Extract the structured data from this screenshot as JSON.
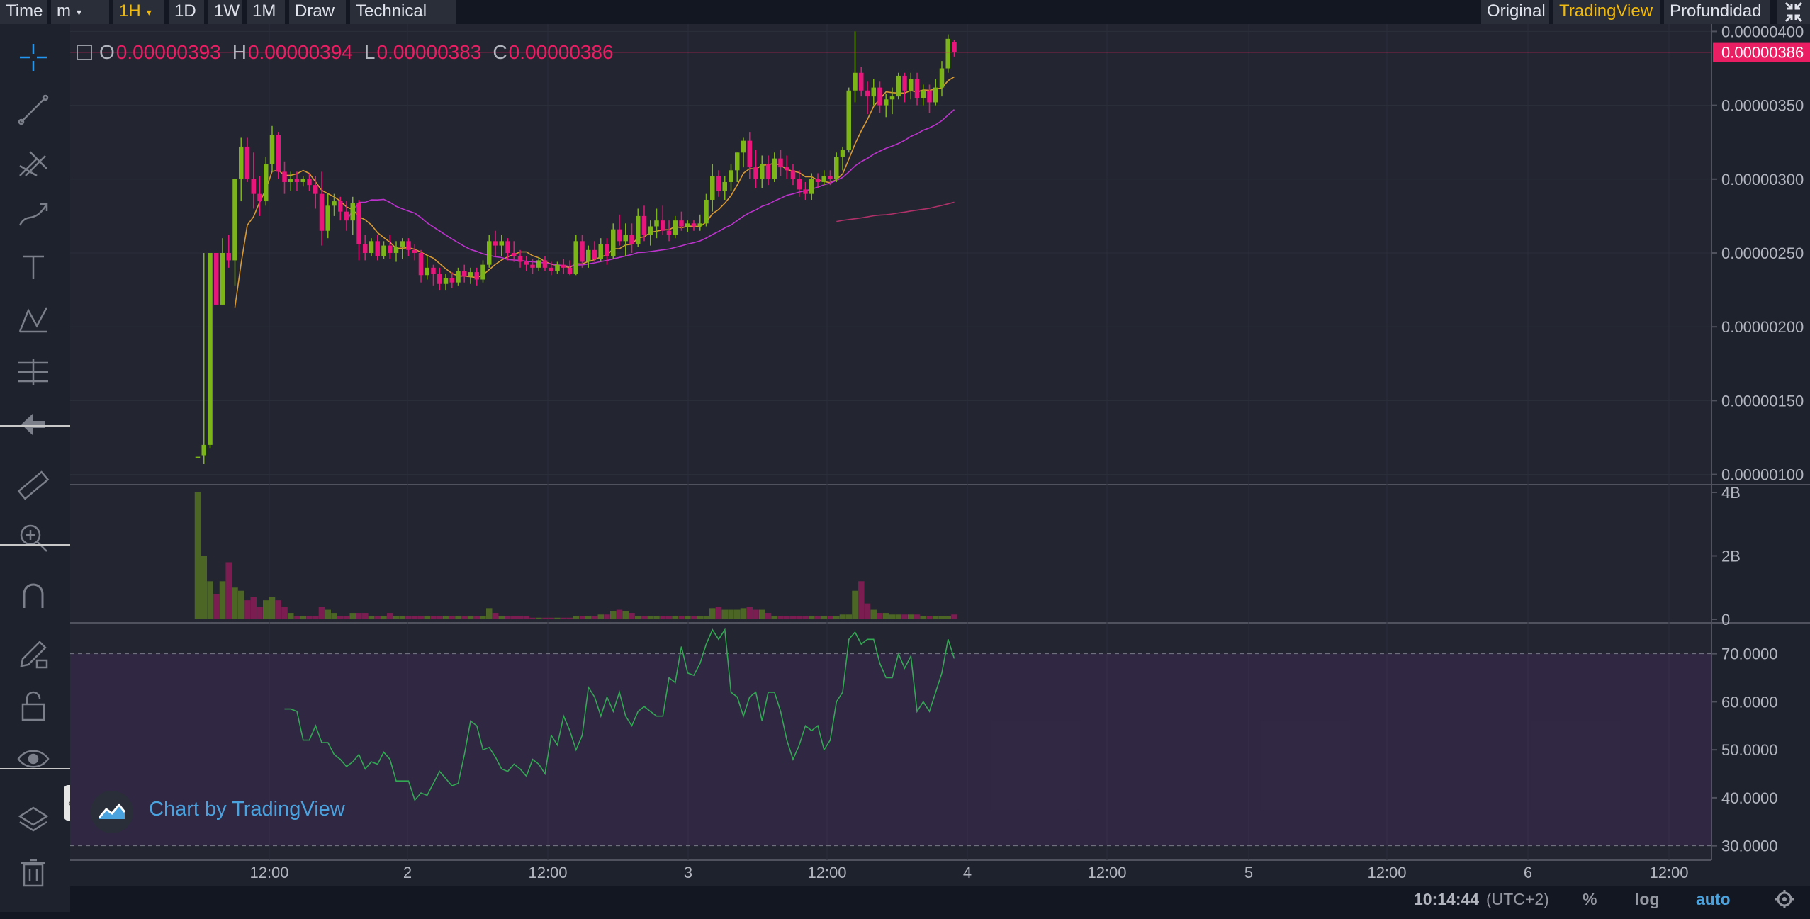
{
  "toolbar": {
    "items": [
      {
        "label": "Time"
      },
      {
        "label": "m",
        "caret": "▾"
      },
      {
        "label": "1H",
        "caret": "▾",
        "active": true
      },
      {
        "label": "1D"
      },
      {
        "label": "1W"
      },
      {
        "label": "1M"
      },
      {
        "label": "Draw"
      },
      {
        "label": "Technical Ind"
      }
    ],
    "views": [
      {
        "label": "Original"
      },
      {
        "label": "TradingView",
        "active": true
      },
      {
        "label": "Profundidad"
      }
    ],
    "fullscreen_icon": "collapse-arrows-icon"
  },
  "left_tools": [
    "crosshair-icon",
    "trend-line-icon",
    "pitchfork-icon",
    "brush-icon",
    "text-icon",
    "pattern-icon",
    "fib-levels-icon",
    "back-arrow-icon",
    "ruler-icon",
    "zoom-in-icon",
    "magnet-icon",
    "lock-drawing-icon",
    "unlock-icon",
    "eye-icon",
    "layers-icon",
    "trash-icon"
  ],
  "legend": {
    "o_label": "O",
    "o_value": "0.00000393",
    "h_label": "H",
    "h_value": "0.00000394",
    "l_label": "L",
    "l_value": "0.00000383",
    "c_label": "C",
    "c_value": "0.00000386"
  },
  "watermark": "Chart by TradingView",
  "bottom_bar": {
    "time": "10:14:44",
    "tz": "(UTC+2)",
    "percent": "%",
    "log": "log",
    "auto": "auto",
    "settings_icon": "gear-icon"
  },
  "colors": {
    "up": "#7cb518",
    "down": "#e8157b",
    "ma_short": "#d99a33",
    "ma_mid": "#bb33cc",
    "ma_long": "#b0306a",
    "rsi": "#32a852",
    "accent": "#f0b90b",
    "price_tag": "#e91e63"
  },
  "chart_data": {
    "type": "candlestick",
    "price_axis": {
      "ylim": [
        9.5e-07,
        4.05e-06
      ],
      "ticks": [
        "0.00000400",
        "0.00000350",
        "0.00000300",
        "0.00000250",
        "0.00000200",
        "0.00000150",
        "0.00000100"
      ],
      "last_price": "0.00000386"
    },
    "time_axis": {
      "labels": [
        "12:00",
        "2",
        "12:00",
        "3",
        "12:00",
        "4",
        "12:00",
        "5",
        "12:00",
        "6",
        "12:00"
      ]
    },
    "candles_ohlc": [
      [
        112,
        112,
        112,
        112
      ],
      [
        113,
        250,
        107,
        120
      ],
      [
        120,
        250,
        118,
        250
      ],
      [
        250,
        250,
        215,
        215
      ],
      [
        215,
        260,
        215,
        250
      ],
      [
        250,
        262,
        240,
        245
      ],
      [
        245,
        300,
        228,
        300
      ],
      [
        300,
        328,
        285,
        322
      ],
      [
        322,
        328,
        298,
        300
      ],
      [
        300,
        318,
        280,
        290
      ],
      [
        290,
        302,
        275,
        285
      ],
      [
        285,
        315,
        282,
        310
      ],
      [
        310,
        336,
        305,
        330
      ],
      [
        330,
        332,
        300,
        305
      ],
      [
        305,
        312,
        290,
        298
      ],
      [
        298,
        305,
        292,
        300
      ],
      [
        300,
        305,
        292,
        298
      ],
      [
        298,
        302,
        295,
        300
      ],
      [
        300,
        304,
        292,
        296
      ],
      [
        296,
        302,
        280,
        290
      ],
      [
        290,
        305,
        255,
        265
      ],
      [
        265,
        290,
        260,
        282
      ],
      [
        282,
        290,
        275,
        285
      ],
      [
        285,
        288,
        272,
        278
      ],
      [
        278,
        285,
        265,
        272
      ],
      [
        272,
        288,
        262,
        284
      ],
      [
        284,
        286,
        245,
        256
      ],
      [
        256,
        262,
        245,
        250
      ],
      [
        250,
        260,
        248,
        258
      ],
      [
        258,
        262,
        245,
        248
      ],
      [
        248,
        258,
        246,
        255
      ],
      [
        255,
        262,
        246,
        250
      ],
      [
        250,
        258,
        244,
        254
      ],
      [
        254,
        260,
        246,
        258
      ],
      [
        258,
        260,
        248,
        252
      ],
      [
        252,
        256,
        245,
        250
      ],
      [
        250,
        252,
        230,
        235
      ],
      [
        235,
        248,
        232,
        240
      ],
      [
        240,
        242,
        228,
        236
      ],
      [
        236,
        240,
        225,
        229
      ],
      [
        229,
        236,
        225,
        233
      ],
      [
        233,
        237,
        226,
        230
      ],
      [
        230,
        240,
        228,
        238
      ],
      [
        238,
        242,
        230,
        234
      ],
      [
        234,
        240,
        229,
        237
      ],
      [
        237,
        240,
        228,
        232
      ],
      [
        232,
        245,
        230,
        242
      ],
      [
        242,
        262,
        240,
        258
      ],
      [
        258,
        265,
        248,
        255
      ],
      [
        255,
        262,
        248,
        258
      ],
      [
        258,
        260,
        245,
        250
      ],
      [
        250,
        258,
        244,
        248
      ],
      [
        248,
        252,
        240,
        244
      ],
      [
        244,
        248,
        238,
        242
      ],
      [
        242,
        246,
        236,
        240
      ],
      [
        240,
        247,
        238,
        245
      ],
      [
        245,
        248,
        238,
        240
      ],
      [
        240,
        244,
        235,
        238
      ],
      [
        238,
        244,
        236,
        242
      ],
      [
        242,
        246,
        236,
        240
      ],
      [
        240,
        245,
        235,
        236
      ],
      [
        236,
        262,
        235,
        258
      ],
      [
        258,
        262,
        240,
        244
      ],
      [
        244,
        255,
        240,
        252
      ],
      [
        252,
        258,
        244,
        246
      ],
      [
        246,
        260,
        244,
        256
      ],
      [
        256,
        260,
        242,
        248
      ],
      [
        248,
        270,
        246,
        266
      ],
      [
        266,
        276,
        255,
        258
      ],
      [
        258,
        270,
        248,
        262
      ],
      [
        262,
        270,
        250,
        256
      ],
      [
        256,
        280,
        254,
        275
      ],
      [
        275,
        282,
        258,
        262
      ],
      [
        262,
        272,
        255,
        268
      ],
      [
        268,
        280,
        260,
        272
      ],
      [
        272,
        282,
        262,
        265
      ],
      [
        265,
        272,
        258,
        262
      ],
      [
        262,
        275,
        260,
        272
      ],
      [
        272,
        278,
        265,
        268
      ],
      [
        268,
        272,
        264,
        270
      ],
      [
        270,
        272,
        265,
        268
      ],
      [
        268,
        276,
        265,
        270
      ],
      [
        270,
        290,
        268,
        286
      ],
      [
        286,
        310,
        278,
        302
      ],
      [
        302,
        306,
        288,
        292
      ],
      [
        292,
        302,
        286,
        298
      ],
      [
        298,
        310,
        292,
        306
      ],
      [
        306,
        318,
        298,
        318
      ],
      [
        318,
        328,
        308,
        326
      ],
      [
        326,
        332,
        300,
        308
      ],
      [
        308,
        320,
        294,
        300
      ],
      [
        300,
        316,
        294,
        310
      ],
      [
        310,
        316,
        296,
        300
      ],
      [
        300,
        318,
        298,
        314
      ],
      [
        314,
        320,
        302,
        308
      ],
      [
        308,
        316,
        300,
        306
      ],
      [
        306,
        310,
        296,
        300
      ],
      [
        300,
        306,
        288,
        293
      ],
      [
        293,
        298,
        286,
        290
      ],
      [
        290,
        304,
        286,
        300
      ],
      [
        300,
        304,
        294,
        298
      ],
      [
        298,
        306,
        296,
        302
      ],
      [
        302,
        306,
        296,
        300
      ],
      [
        300,
        318,
        298,
        315
      ],
      [
        315,
        322,
        306,
        320
      ],
      [
        320,
        362,
        318,
        360
      ],
      [
        360,
        400,
        352,
        372
      ],
      [
        372,
        376,
        356,
        360
      ],
      [
        360,
        366,
        344,
        356
      ],
      [
        356,
        368,
        350,
        362
      ],
      [
        362,
        366,
        345,
        350
      ],
      [
        350,
        358,
        342,
        354
      ],
      [
        354,
        362,
        344,
        356
      ],
      [
        356,
        372,
        354,
        370
      ],
      [
        370,
        372,
        352,
        360
      ],
      [
        360,
        372,
        354,
        368
      ],
      [
        368,
        372,
        350,
        355
      ],
      [
        355,
        364,
        350,
        360
      ],
      [
        360,
        364,
        345,
        352
      ],
      [
        352,
        368,
        350,
        362
      ],
      [
        362,
        380,
        356,
        375
      ],
      [
        375,
        398,
        372,
        395
      ],
      [
        393,
        394,
        383,
        386
      ]
    ],
    "volume_axis": {
      "ylim": [
        0,
        4
      ],
      "unit": "B",
      "ticks": [
        "4B",
        "2B",
        "0"
      ]
    },
    "volume": [
      4.0,
      2.0,
      1.2,
      0.8,
      1.2,
      1.8,
      1.0,
      0.9,
      0.6,
      0.7,
      0.4,
      0.6,
      0.7,
      0.6,
      0.4,
      0.2,
      0.1,
      0.1,
      0.1,
      0.1,
      0.4,
      0.3,
      0.2,
      0.1,
      0.1,
      0.2,
      0.2,
      0.2,
      0.1,
      0.1,
      0.1,
      0.2,
      0.1,
      0.1,
      0.1,
      0.1,
      0.1,
      0.1,
      0.1,
      0.1,
      0.1,
      0.1,
      0.1,
      0.1,
      0.1,
      0.1,
      0.1,
      0.35,
      0.2,
      0.1,
      0.1,
      0.1,
      0.1,
      0.1,
      0.05,
      0.05,
      0.05,
      0.05,
      0.05,
      0.05,
      0.05,
      0.1,
      0.1,
      0.1,
      0.1,
      0.15,
      0.15,
      0.25,
      0.3,
      0.25,
      0.2,
      0.1,
      0.1,
      0.1,
      0.1,
      0.1,
      0.1,
      0.1,
      0.1,
      0.1,
      0.1,
      0.1,
      0.1,
      0.35,
      0.4,
      0.3,
      0.3,
      0.3,
      0.35,
      0.4,
      0.3,
      0.3,
      0.2,
      0.1,
      0.1,
      0.1,
      0.1,
      0.1,
      0.1,
      0.1,
      0.1,
      0.1,
      0.1,
      0.1,
      0.15,
      0.15,
      0.9,
      1.2,
      0.5,
      0.3,
      0.2,
      0.2,
      0.15,
      0.15,
      0.15,
      0.15,
      0.15,
      0.1,
      0.1,
      0.1,
      0.1,
      0.1,
      0.15,
      0.4,
      0.15
    ],
    "rsi_axis": {
      "ylim": [
        27,
        76
      ],
      "ticks": [
        "70.0000",
        "60.0000",
        "50.0000",
        "40.0000",
        "30.0000"
      ],
      "bands": [
        70,
        30
      ]
    },
    "rsi_start_index": 14,
    "rsi": [
      58.5,
      58.5,
      58,
      52,
      52,
      55,
      51.5,
      51.5,
      49,
      48,
      46.5,
      47.5,
      49,
      46,
      47.5,
      47,
      49.5,
      48,
      43.5,
      43.5,
      43.5,
      39.5,
      41,
      40.5,
      43,
      45.5,
      44,
      42.5,
      43,
      49,
      56,
      55,
      50,
      50.5,
      48.5,
      46,
      45.5,
      47,
      46,
      44.5,
      48,
      47,
      45,
      53,
      51,
      57,
      54,
      50,
      53,
      63,
      61,
      57,
      61,
      58,
      62,
      57,
      55,
      58,
      59,
      58,
      57,
      57,
      65,
      64,
      71.5,
      66,
      65.5,
      68,
      72,
      75,
      73,
      75,
      62,
      61,
      57,
      61,
      62,
      56,
      62,
      62,
      58,
      52,
      48,
      51,
      55,
      54,
      55,
      50,
      52,
      60,
      62,
      73,
      74.5,
      72,
      73,
      73,
      68,
      65,
      65,
      70,
      67,
      69.5,
      58,
      60,
      58,
      62,
      66,
      73,
      69
    ],
    "ma_short_start": 4,
    "ma_mid_start": 16,
    "ma_long_start": 103
  }
}
